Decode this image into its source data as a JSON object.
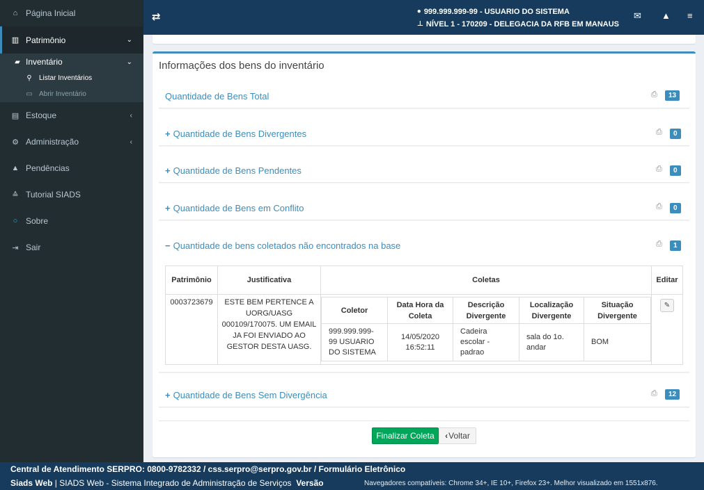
{
  "sidebar": {
    "items": [
      {
        "label": "Página Inicial",
        "icon": "home-icon"
      },
      {
        "label": "Patrimônio",
        "icon": "barcode-icon"
      },
      {
        "label": "Inventário",
        "icon": "book-icon"
      },
      {
        "label": "Listar Inventários",
        "icon": "search-icon"
      },
      {
        "label": "Abrir Inventário",
        "icon": "folder-open-icon"
      },
      {
        "label": "Estoque",
        "icon": "inbox-icon"
      },
      {
        "label": "Administração",
        "icon": "cogs-icon"
      },
      {
        "label": "Pendências",
        "icon": "warning-icon"
      },
      {
        "label": "Tutorial SIADS",
        "icon": "graduation-cap-icon"
      },
      {
        "label": "Sobre",
        "icon": "circle-icon"
      },
      {
        "label": "Sair",
        "icon": "sign-in-icon"
      }
    ]
  },
  "header": {
    "user": "999.999.999-99 - USUARIO DO SISTEMA",
    "level": "NÍVEL 1 - 170209 - DELEGACIA DA RFB EM MANAUS"
  },
  "main": {
    "box_title": "Informações dos bens do inventário",
    "panels": [
      {
        "label": "Quantidade de Bens Total",
        "count": "13",
        "expand": ""
      },
      {
        "label": "Quantidade de Bens Divergentes",
        "count": "0",
        "expand": "+"
      },
      {
        "label": "Quantidade de Bens Pendentes",
        "count": "0",
        "expand": "+"
      },
      {
        "label": "Quantidade de Bens em Conflito",
        "count": "0",
        "expand": "+"
      },
      {
        "label": "Quantidade de bens coletados não encontrados na base",
        "count": "1",
        "expand": "−"
      },
      {
        "label": "Quantidade de Bens Sem Divergência",
        "count": "12",
        "expand": "+"
      }
    ],
    "table": {
      "headers": {
        "patrimonio": "Patrimônio",
        "justificativa": "Justificativa",
        "coletas": "Coletas",
        "editar": "Editar"
      },
      "inner_headers": [
        "Coletor",
        "Data Hora da Coleta",
        "Descrição Divergente",
        "Localização Divergente",
        "Situação Divergente"
      ],
      "row": {
        "patrimonio": "0003723679",
        "justificativa": "ESTE BEM PERTENCE A UORG/UASG 000109/170075. UM EMAIL JA FOI ENVIADO AO GESTOR DESTA UASG.",
        "coleta": [
          "999.999.999-99 USUARIO DO SISTEMA",
          "14/05/2020 16:52:11",
          "Cadeira escolar - padrao",
          "sala do 1o. andar",
          "BOM"
        ]
      }
    },
    "buttons": {
      "finalizar": "Finalizar Coleta",
      "voltar": "Voltar"
    }
  },
  "footer": {
    "line1": "Central de Atendimento SERPRO: 0800-9782332 / css.serpro@serpro.gov.br / Formulário Eletrônico",
    "brand": "Siads Web",
    "desc": " | SIADS Web - Sistema Integrado de Administração de Serviços",
    "versao": "Versão",
    "browsers": "Navegadores compatíveis: Chrome 34+, IE 10+, Firefox 23+. Melhor visualizado em 1551x876."
  },
  "colors": {
    "header": "#173b5c",
    "sidebar": "#222d32",
    "accent": "#3c8dbc",
    "success": "#00a65a"
  }
}
